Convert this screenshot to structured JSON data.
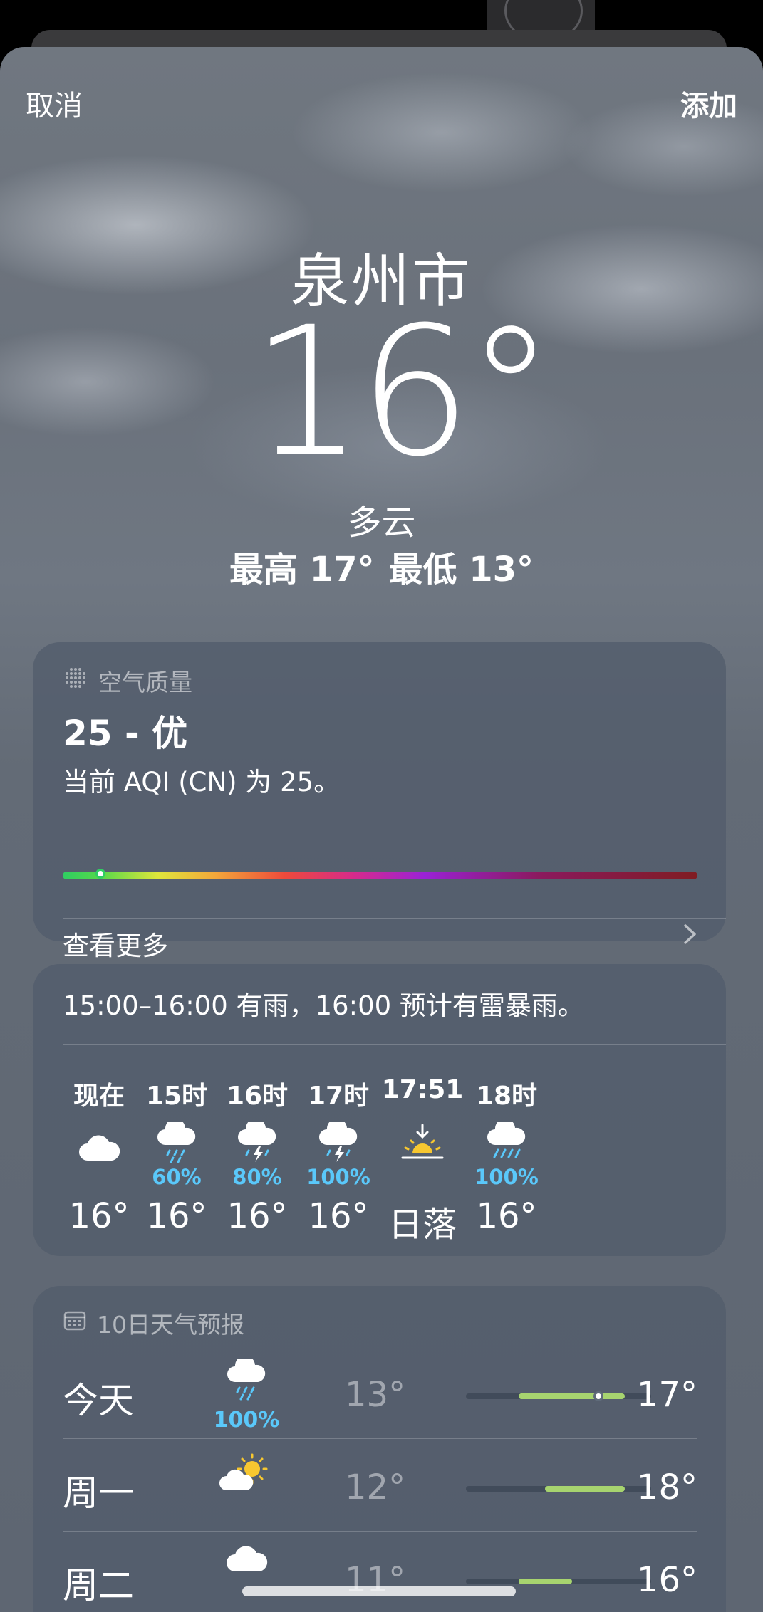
{
  "status_bar": {},
  "nav": {
    "cancel_label": "取消",
    "add_label": "添加"
  },
  "weather": {
    "city": "泉州市",
    "temperature": "16°",
    "condition": "多云",
    "high": "最高 17°",
    "low": "最低 13°"
  },
  "air_quality": {
    "title": "空气质量",
    "value": "25 - 优",
    "description": "当前 AQI (CN) 为 25。",
    "level_fraction": 0.06,
    "more_label": "查看更多"
  },
  "hourly": {
    "summary": "15:00–16:00 有雨，16:00 预计有雷暴雨。",
    "items": [
      {
        "label": "现在",
        "icon": "cloud-icon",
        "precip": "",
        "value": "16°"
      },
      {
        "label": "15时",
        "icon": "rain-cloud-icon",
        "precip": "60%",
        "value": "16°"
      },
      {
        "label": "16时",
        "icon": "thunderstorm-icon",
        "precip": "80%",
        "value": "16°"
      },
      {
        "label": "17时",
        "icon": "thunderstorm-icon",
        "precip": "100%",
        "value": "16°"
      },
      {
        "label": "17:51",
        "icon": "sunset-icon",
        "precip": "",
        "value": "日落"
      },
      {
        "label": "18时",
        "icon": "heavy-rain-icon",
        "precip": "100%",
        "value": "16°"
      }
    ]
  },
  "daily": {
    "title": "10日天气预报",
    "range_min": 11,
    "range_max": 18,
    "items": [
      {
        "day": "今天",
        "icon": "rain-cloud-icon",
        "precip": "100%",
        "low": "13°",
        "high": "17°",
        "low_value": 13,
        "high_value": 17,
        "current_value": 16
      },
      {
        "day": "周一",
        "icon": "partly-sunny-icon",
        "precip": "",
        "low": "12°",
        "high": "18°",
        "low_value": 14,
        "high_value": 17
      },
      {
        "day": "周二",
        "icon": "cloud-icon",
        "precip": "",
        "low": "11°",
        "high": "16°",
        "low_value": 13,
        "high_value": 15
      }
    ]
  },
  "colors": {
    "precip_blue": "#5ac8fa",
    "temp_range_green": "#a7d46f",
    "sun_yellow": "#f7c730"
  }
}
